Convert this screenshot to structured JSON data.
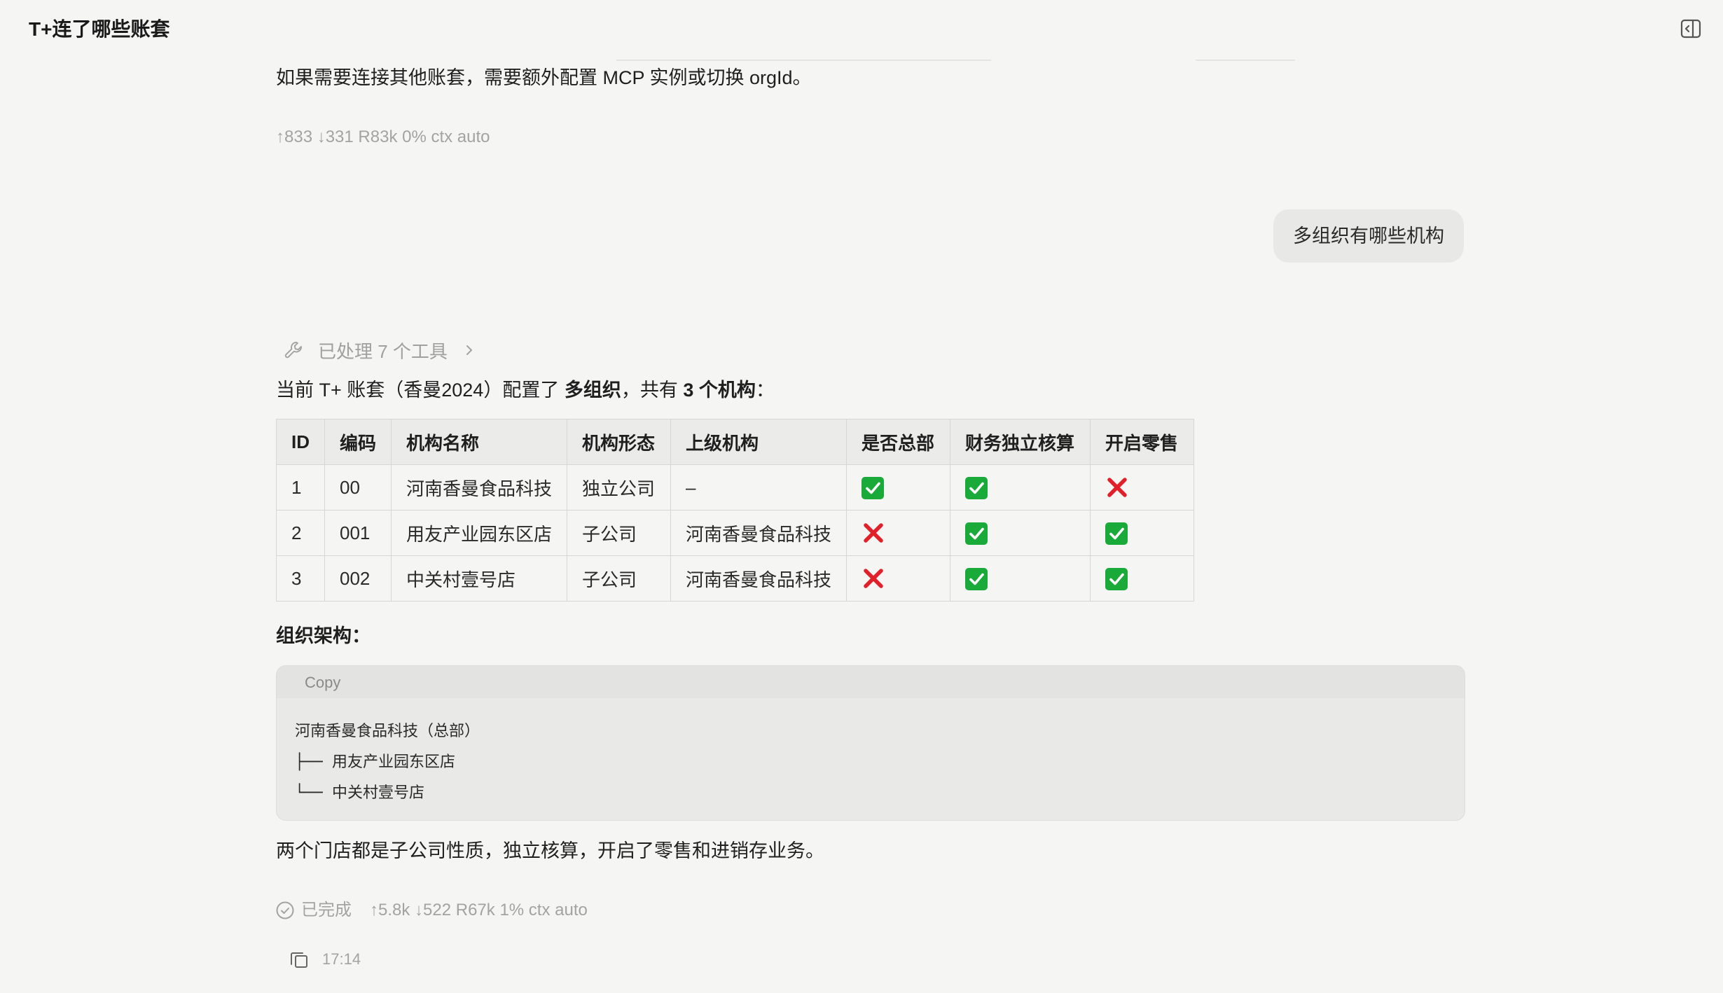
{
  "header": {
    "title": "T+连了哪些账套"
  },
  "prev_message": {
    "text": "如果需要连接其他账套，需要额外配置 MCP 实例或切换 orgId。",
    "stats": "↑833 ↓331 R83k 0% ctx auto"
  },
  "user_message": {
    "text": "多组织有哪些机构"
  },
  "assistant": {
    "tools_label": "已处理 7 个工具",
    "intro": {
      "before": "当前 T+ 账套（香曼2024）配置了 ",
      "bold1": "多组织",
      "middle": "，共有 ",
      "bold2": "3 个机构",
      "after": "："
    },
    "table": {
      "headers": [
        "ID",
        "编码",
        "机构名称",
        "机构形态",
        "上级机构",
        "是否总部",
        "财务独立核算",
        "开启零售"
      ],
      "rows": [
        {
          "id": "1",
          "code": "00",
          "name": "河南香曼食品科技",
          "form": "独立公司",
          "parent": "–",
          "hq": true,
          "independent": true,
          "retail": false
        },
        {
          "id": "2",
          "code": "001",
          "name": "用友产业园东区店",
          "form": "子公司",
          "parent": "河南香曼食品科技",
          "hq": false,
          "independent": true,
          "retail": true
        },
        {
          "id": "3",
          "code": "002",
          "name": "中关村壹号店",
          "form": "子公司",
          "parent": "河南香曼食品科技",
          "hq": false,
          "independent": true,
          "retail": true
        }
      ]
    },
    "structure_heading": "组织架构：",
    "code_block": {
      "copy_label": "Copy",
      "lines": [
        "河南香曼食品科技（总部）",
        "├── 用友产业园东区店",
        "└── 中关村壹号店"
      ]
    },
    "summary": "两个门店都是子公司性质，独立核算，开启了零售和进销存业务。",
    "status": "已完成",
    "stats": "↑5.8k ↓522 R67k 1% ctx auto",
    "time": "17:14"
  },
  "icons": {
    "panel": "sidebar-toggle-icon",
    "tools": "wrench-icon",
    "chevron": "chevron-right-icon",
    "done": "check-circle-icon",
    "copy": "copy-icon",
    "yes": "check-mark-button-icon",
    "no": "cross-mark-icon"
  },
  "colors": {
    "check": "#1aaa3a",
    "cross": "#e0202a",
    "background": "#f5f5f4"
  }
}
